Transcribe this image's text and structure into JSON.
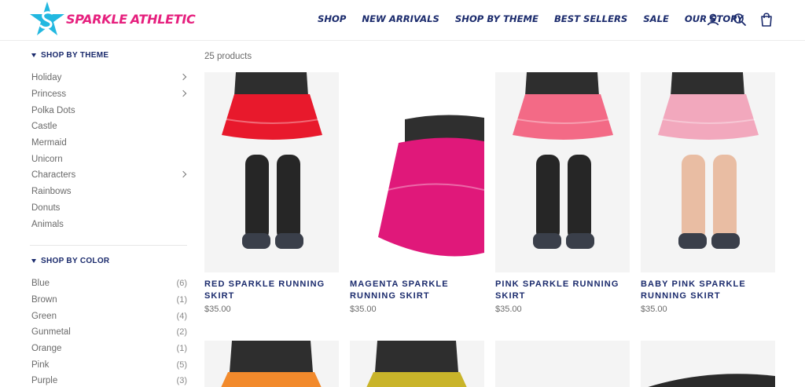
{
  "brand": {
    "name_part1": "SPARKLE",
    "name_part2": "ATHLETIC",
    "logo_icon": "star-s-logo-icon",
    "colors": {
      "pink": "#e6207e",
      "cyan": "#22b8e0",
      "navy": "#1a2a6c"
    }
  },
  "nav": {
    "items": [
      "SHOP",
      "NEW ARRIVALS",
      "SHOP BY THEME",
      "BEST SELLERS",
      "SALE",
      "OUR STORY"
    ],
    "icons": [
      "user-icon",
      "search-icon",
      "cart-icon"
    ]
  },
  "sidebar": {
    "theme": {
      "title": "SHOP BY THEME",
      "items": [
        {
          "label": "Holiday",
          "has_sub": true
        },
        {
          "label": "Princess",
          "has_sub": true
        },
        {
          "label": "Polka Dots",
          "has_sub": false
        },
        {
          "label": "Castle",
          "has_sub": false
        },
        {
          "label": "Mermaid",
          "has_sub": false
        },
        {
          "label": "Unicorn",
          "has_sub": false
        },
        {
          "label": "Characters",
          "has_sub": true
        },
        {
          "label": "Rainbows",
          "has_sub": false
        },
        {
          "label": "Donuts",
          "has_sub": false
        },
        {
          "label": "Animals",
          "has_sub": false
        }
      ]
    },
    "color": {
      "title": "SHOP BY COLOR",
      "items": [
        {
          "label": "Blue",
          "count": "(6)"
        },
        {
          "label": "Brown",
          "count": "(1)"
        },
        {
          "label": "Green",
          "count": "(4)"
        },
        {
          "label": "Gunmetal",
          "count": "(2)"
        },
        {
          "label": "Orange",
          "count": "(1)"
        },
        {
          "label": "Pink",
          "count": "(5)"
        },
        {
          "label": "Purple",
          "count": "(3)"
        }
      ]
    }
  },
  "main": {
    "product_count": "25 products",
    "products": [
      {
        "title": "RED SPARKLE RUNNING SKIRT",
        "price": "$35.00",
        "skirt_color": "#e8192c"
      },
      {
        "title": "MAGENTA SPARKLE RUNNING SKIRT",
        "price": "$35.00",
        "skirt_color": "#e0187a"
      },
      {
        "title": "PINK SPARKLE RUNNING SKIRT",
        "price": "$35.00",
        "skirt_color": "#f36a86"
      },
      {
        "title": "BABY PINK SPARKLE RUNNING SKIRT",
        "price": "$35.00",
        "skirt_color": "#f2a8bd"
      }
    ],
    "second_row": [
      {
        "skirt_color": "#f28a2c"
      },
      {
        "skirt_color": "#c9b42a"
      },
      {
        "skirt_color": "#f2f2f2"
      },
      {
        "skirt_color": "#2a2a2a"
      }
    ]
  }
}
